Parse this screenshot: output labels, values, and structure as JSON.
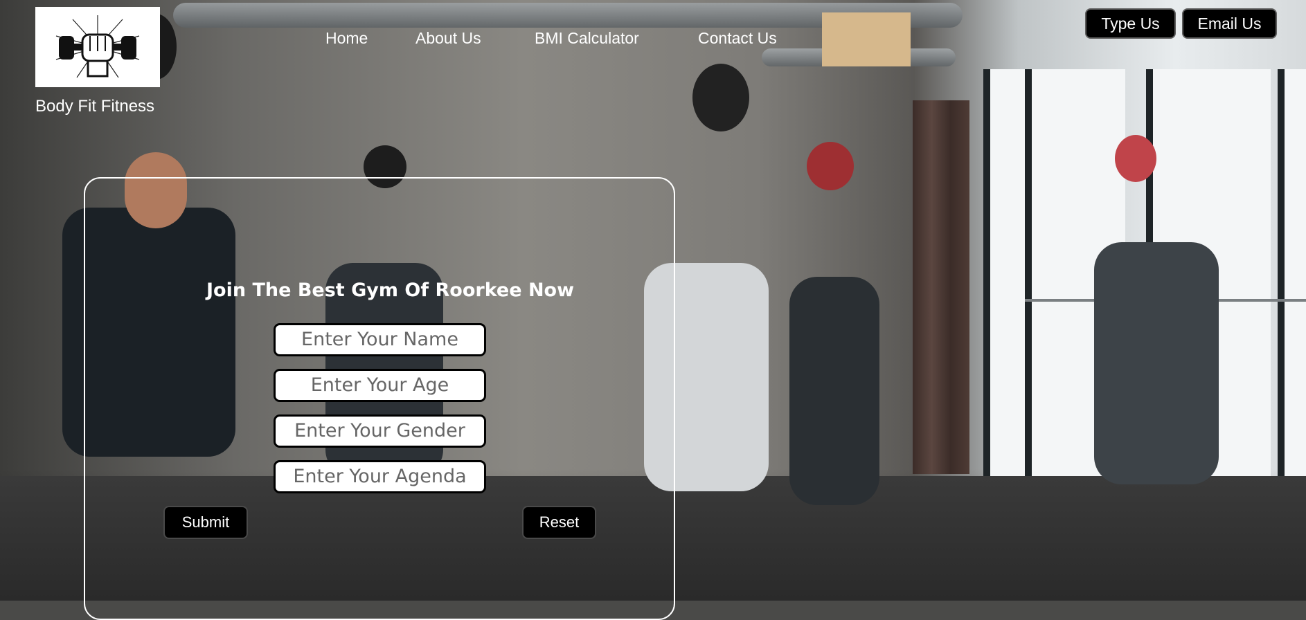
{
  "brand": {
    "name": "Body Fit Fitness",
    "logo_icon": "fist-dumbbell-icon"
  },
  "nav": {
    "items": [
      {
        "label": "Home"
      },
      {
        "label": "About Us"
      },
      {
        "label": "BMI Calculator"
      },
      {
        "label": "Contact Us"
      }
    ]
  },
  "actions": {
    "type_us": "Type Us",
    "email_us": "Email Us"
  },
  "form": {
    "title": "Join The Best Gym Of Roorkee Now",
    "name_placeholder": "Enter Your Name",
    "age_placeholder": "Enter Your Age",
    "gender_placeholder": "Enter Your Gender",
    "agenda_placeholder": "Enter Your Agenda",
    "submit_label": "Submit",
    "reset_label": "Reset"
  },
  "colors": {
    "button_bg": "#000000",
    "text_light": "#ffffff",
    "panel_border": "#ffffff",
    "placeholder": "#666666"
  }
}
